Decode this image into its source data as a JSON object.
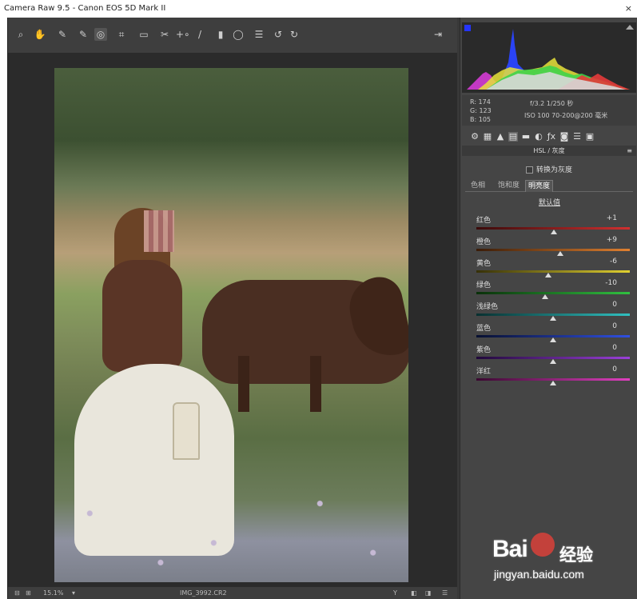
{
  "window": {
    "title": "Camera Raw 9.5 -  Canon EOS 5D Mark II",
    "close": "×"
  },
  "toolbar": {
    "tools": [
      "zoom-icon",
      "hand-icon",
      "white-balance-icon",
      "color-sampler-icon",
      "target-adjust-icon",
      "crop-icon",
      "straighten-icon",
      "spot-removal-icon",
      "red-eye-icon",
      "adjustment-brush-icon",
      "graduated-filter-icon",
      "radial-filter-icon",
      "preferences-icon",
      "rotate-ccw-icon",
      "rotate-cw-icon",
      "export-icon"
    ],
    "glyphs": [
      "⌕",
      "✋",
      "✎",
      "✎",
      "◎",
      "⌗",
      "▭",
      "✂",
      "+∘",
      "/",
      "▮",
      "◯",
      "☰",
      "↺",
      "↻",
      "⇥"
    ]
  },
  "statusbar": {
    "zoom": "15.1%",
    "filename": "IMG_3992.CR2",
    "view_buttons": [
      "Y",
      "◧",
      "◨",
      "☰"
    ]
  },
  "panel": {
    "readout": {
      "r": "R:  174",
      "g": "G:  123",
      "b": "B:  105",
      "exposure": "f/3.2   1/250 秒",
      "iso": "ISO 100   70-200@200 毫米"
    },
    "tab_icons": [
      "basic-icon",
      "tone-curve-icon",
      "detail-icon",
      "hsl-icon",
      "split-toning-icon",
      "lens-icon",
      "fx-icon",
      "camera-calibration-icon",
      "presets-icon",
      "snapshots-icon"
    ],
    "tab_glyphs": [
      "⚙",
      "▦",
      "▲",
      "▤",
      "▬",
      "◐",
      "ƒx",
      "◙",
      "☰",
      "▣"
    ],
    "section_title": "HSL / 灰度",
    "convert_label": "转换为灰度",
    "subtabs": [
      "色相",
      "饱和度",
      "明亮度"
    ],
    "defaults_link": "默认值",
    "sliders": [
      {
        "label": "红色",
        "value": "+1",
        "pos": 0.505,
        "colors": [
          "#3a0a0a",
          "#d03030"
        ]
      },
      {
        "label": "橙色",
        "value": "+9",
        "pos": 0.545,
        "colors": [
          "#3a1c08",
          "#e08030"
        ]
      },
      {
        "label": "黄色",
        "value": "-6",
        "pos": 0.47,
        "colors": [
          "#363008",
          "#e0d030"
        ]
      },
      {
        "label": "绿色",
        "value": "-10",
        "pos": 0.45,
        "colors": [
          "#0a300a",
          "#30c040"
        ]
      },
      {
        "label": "浅绿色",
        "value": "0",
        "pos": 0.5,
        "colors": [
          "#083030",
          "#30c0c0"
        ]
      },
      {
        "label": "蓝色",
        "value": "0",
        "pos": 0.5,
        "colors": [
          "#081030",
          "#3050e0"
        ]
      },
      {
        "label": "紫色",
        "value": "0",
        "pos": 0.5,
        "colors": [
          "#20083a",
          "#9a40d8"
        ]
      },
      {
        "label": "洋红",
        "value": "0",
        "pos": 0.5,
        "colors": [
          "#3a0830",
          "#e040c0"
        ]
      }
    ]
  },
  "watermark": {
    "brand": "Bai  经验",
    "sub": "经验",
    "url": "jingyan.baidu.com"
  }
}
